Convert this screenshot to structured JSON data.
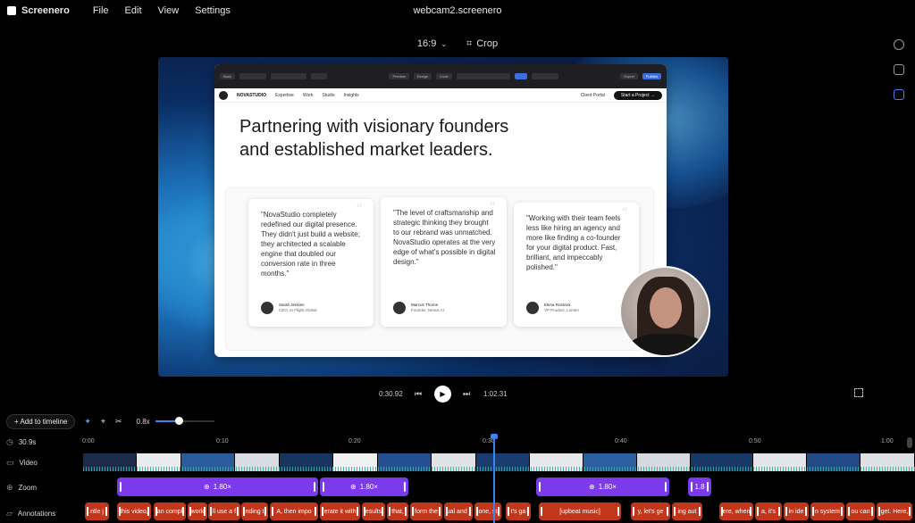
{
  "app": {
    "name": "Screenero",
    "window_title": "webcam2.screenero"
  },
  "menu": [
    "File",
    "Edit",
    "View",
    "Settings"
  ],
  "toolbar": {
    "aspect": "16:9",
    "crop": "Crop"
  },
  "preview": {
    "browser_chrome": {
      "back": "Back",
      "tabs": [
        "Preview",
        "Design",
        "Code"
      ],
      "export": "Export",
      "publish": "Publish"
    },
    "site_nav": {
      "brand": "NOVASTUDIO",
      "links": [
        "Expertise",
        "Work",
        "Studio",
        "Insights"
      ],
      "client_portal": "Client Portal",
      "cta": "Start a Project →"
    },
    "headline": "Partnering with visionary founders and established market leaders.",
    "testimonials": [
      {
        "quote": "\"NovaStudio completely redefined our digital presence. They didn't just build a website; they architected a scalable engine that doubled our conversion rate in three months.\"",
        "name": "Sarah Jenkins",
        "role": "CEO, In Flight Global"
      },
      {
        "quote": "\"The level of craftsmanship and strategic thinking they brought to our rebrand was unmatched. NovaStudio operates at the very edge of what's possible in digital design.\"",
        "name": "Marcus Thorne",
        "role": "Founder, Nexus AI"
      },
      {
        "quote": "\"Working with their team feels less like hiring an agency and more like finding a co-founder for your digital product. Fast, brilliant, and impeccably polished.\"",
        "name": "Elena Rostova",
        "role": "VP Product, Lumen"
      }
    ]
  },
  "playback": {
    "current": "0:30.92",
    "total": "1:02.31"
  },
  "timeline_bar": {
    "add": "Add to timeline",
    "zoom_value": "0.8x",
    "zoom_fraction": 0.4
  },
  "ruler": {
    "duration": "30.9s",
    "ticks": [
      "0:00",
      "0:10",
      "0:20",
      "0:30",
      "0:40",
      "0:50",
      "1:00"
    ]
  },
  "tracks": {
    "video": "Video",
    "zoom": "Zoom",
    "annotations": "Annotations"
  },
  "zoom_segments": [
    "1.80×",
    "1.80×",
    "1.80×",
    "1.8"
  ],
  "annotation_segments": [
    "ntle j",
    "this video,",
    "an compl",
    "work",
    "ll use a f",
    "nding t",
    "A, then impo",
    "erate it with",
    "esults",
    "that,",
    "form the",
    "ual and j",
    "one, st",
    "t's ga",
    "[upbeat music]",
    "y, let's ge",
    "ing aut",
    "ere, when",
    "a, it's",
    "in ide",
    "n system",
    "ou can",
    "get. Here,"
  ]
}
